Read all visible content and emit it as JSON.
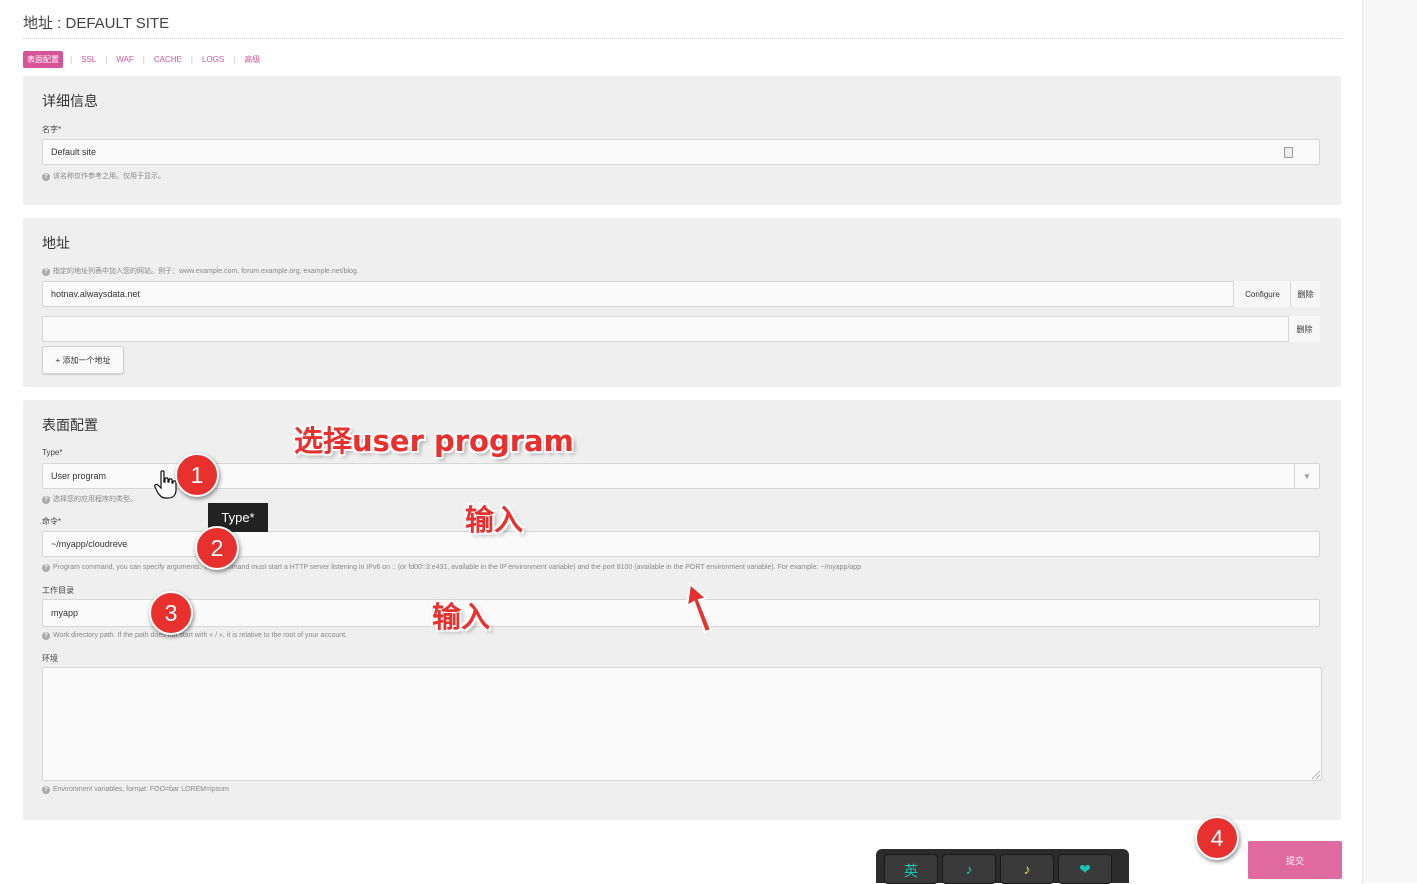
{
  "header": {
    "title": "地址 : DEFAULT SITE"
  },
  "tabs": [
    {
      "label": "表面配置",
      "active": true
    },
    {
      "label": "SSL"
    },
    {
      "label": "WAF"
    },
    {
      "label": "CACHE"
    },
    {
      "label": "LOGS"
    },
    {
      "label": "高级"
    }
  ],
  "details": {
    "title": "详细信息",
    "name_label": "名字*",
    "name_value": "Default site",
    "name_help": "该名称仅作参考之用。仅用于显示。"
  },
  "addresses": {
    "title": "地址",
    "help": "指定的地址列表中加入您的网站。例子：www.example.com, forum.example.org, example.net/blog.",
    "rows": [
      {
        "value": "hotnav.alwaysdata.net",
        "configure_label": "Configure",
        "delete_label": "删除"
      },
      {
        "value": "",
        "delete_label": "删除"
      }
    ],
    "add_label": "+ 添加一个地址"
  },
  "config": {
    "title": "表面配置",
    "type_label": "Type*",
    "type_value": "User program",
    "type_help": "选择您的应用程序的类型。",
    "command_label": "命令*",
    "command_value": "~/myapp/cloudreve",
    "command_help": "Program command, you can specify arguments. This command must start a HTTP server listening in IPv6 on :: (or fd00::3:e431, available in the IP environment variable) and the port 8100 (available in the PORT environment variable). For example: ~/myapp/app",
    "workdir_label": "工作目录",
    "workdir_value": "myapp",
    "workdir_help": "Work directory path. If the path does not start with « / », it is relative to the root of your account.",
    "env_label": "环境",
    "env_value": "",
    "env_help": "Environment variables, format: FOO=bar LOREM=ipsum"
  },
  "submit_label": "提交",
  "tooltip": "Type*",
  "annotations": {
    "select_text": "选择user program",
    "input_text_1": "输入",
    "input_text_2": "输入",
    "badges": [
      "1",
      "2",
      "3",
      "4"
    ],
    "color": "#e8312f"
  },
  "keyboard_keys": [
    "英",
    "♪",
    "♪",
    "❤"
  ],
  "colors": {
    "accent": "#d9539a",
    "submit": "#e06aa0",
    "panel": "#efefef"
  }
}
